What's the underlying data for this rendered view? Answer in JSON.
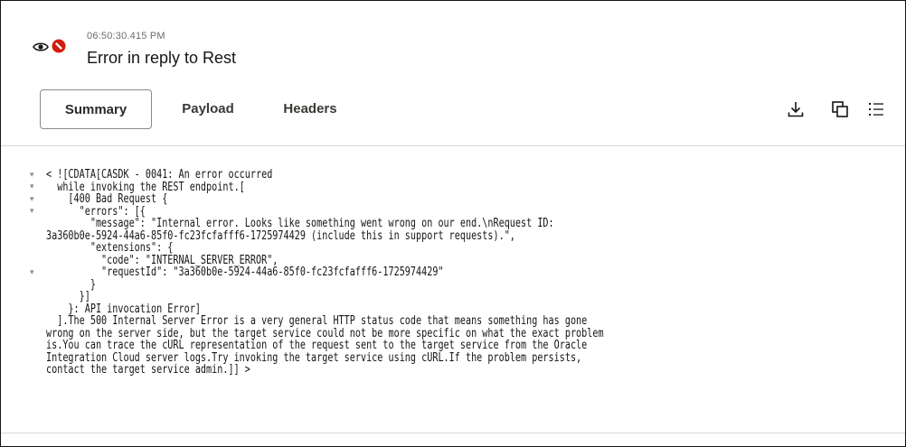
{
  "header": {
    "timestamp": "06:50:30.415 PM",
    "title": "Error in reply to Rest",
    "icons": [
      "eye-icon",
      "error-icon"
    ]
  },
  "tabs": [
    {
      "label": "Summary",
      "active": true
    },
    {
      "label": "Payload",
      "active": false
    },
    {
      "label": "Headers",
      "active": false
    }
  ],
  "toolbar": {
    "icons": [
      "download-icon",
      "copy-icon",
      "list-icon"
    ]
  },
  "code": {
    "lines": [
      "< ![CDATA[CASDK - 0041: An error occurred",
      "  while invoking the REST endpoint.[",
      "    [400 Bad Request {",
      "      \"errors\": [{",
      "        \"message\": \"Internal error. Looks like something went wrong on our end.\\nRequest ID:",
      "3a360b0e-5924-44a6-85f0-fc23fcfafff6-1725974429 (include this in support requests).\",",
      "        \"extensions\": {",
      "          \"code\": \"INTERNAL_SERVER_ERROR\",",
      "          \"requestId\": \"3a360b0e-5924-44a6-85f0-fc23fcfafff6-1725974429\"",
      "        }",
      "      }]",
      "    }: API invocation Error]",
      "  ].The 500 Internal Server Error is a very general HTTP status code that means something has gone",
      "wrong on the server side, but the target service could not be more specific on what the exact problem",
      "is.You can trace the cURL representation of the request sent to the target service from the Oracle",
      "Integration Cloud server logs.Try invoking the target service using cURL.If the problem persists,",
      "contact the target service admin.]] >"
    ]
  },
  "colors": {
    "error_red": "#d21c0e",
    "text": "#161513",
    "muted": "#6f6c68"
  }
}
